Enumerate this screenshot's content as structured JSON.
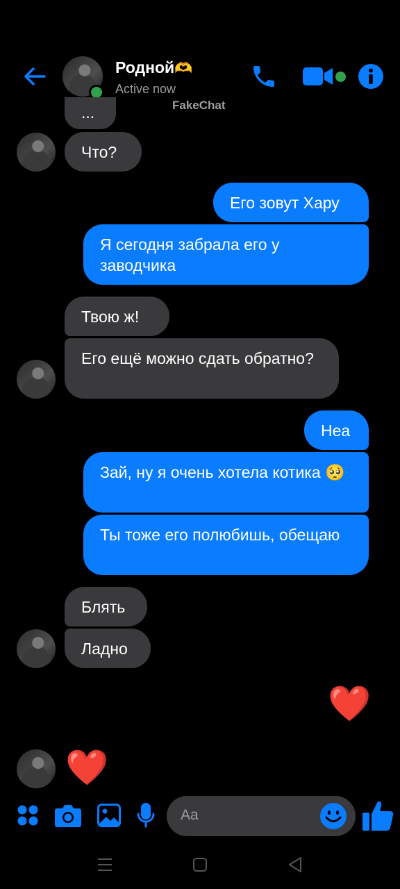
{
  "header": {
    "name": "Родной",
    "name_emoji": "🫶",
    "status": "Active now",
    "watermark": "FakeChat"
  },
  "messages": [
    {
      "dir": "in",
      "text": "..."
    },
    {
      "dir": "in",
      "text": "Что?"
    },
    {
      "dir": "out",
      "text": "Его зовут Хару"
    },
    {
      "dir": "out",
      "text": "Я сегодня забрала его у заводчика"
    },
    {
      "dir": "in",
      "text": "Твою ж!"
    },
    {
      "dir": "in",
      "text": "Его ещё можно сдать обратно?"
    },
    {
      "dir": "out",
      "text": "Неа"
    },
    {
      "dir": "out",
      "text": "Зай, ну я очень хотела котика",
      "emoji": "🥺"
    },
    {
      "dir": "out",
      "text": "Ты тоже его полюбишь, обещаю"
    },
    {
      "dir": "in",
      "text": "Блять"
    },
    {
      "dir": "in",
      "text": "Ладно"
    },
    {
      "dir": "out",
      "text": "❤️"
    },
    {
      "dir": "in",
      "text": "❤️"
    }
  ],
  "composer": {
    "placeholder": "Aa"
  },
  "colors": {
    "accent": "#0a7cff",
    "incoming_bubble": "#3a3a3c",
    "online": "#31a24c",
    "background": "#000000"
  },
  "icons": [
    "back-arrow-icon",
    "phone-icon",
    "video-camera-icon",
    "info-icon",
    "apps-grid-icon",
    "camera-icon",
    "gallery-icon",
    "microphone-icon",
    "emoji-smiley-icon",
    "thumbs-up-icon",
    "nav-menu-icon",
    "nav-home-icon",
    "nav-back-icon"
  ]
}
